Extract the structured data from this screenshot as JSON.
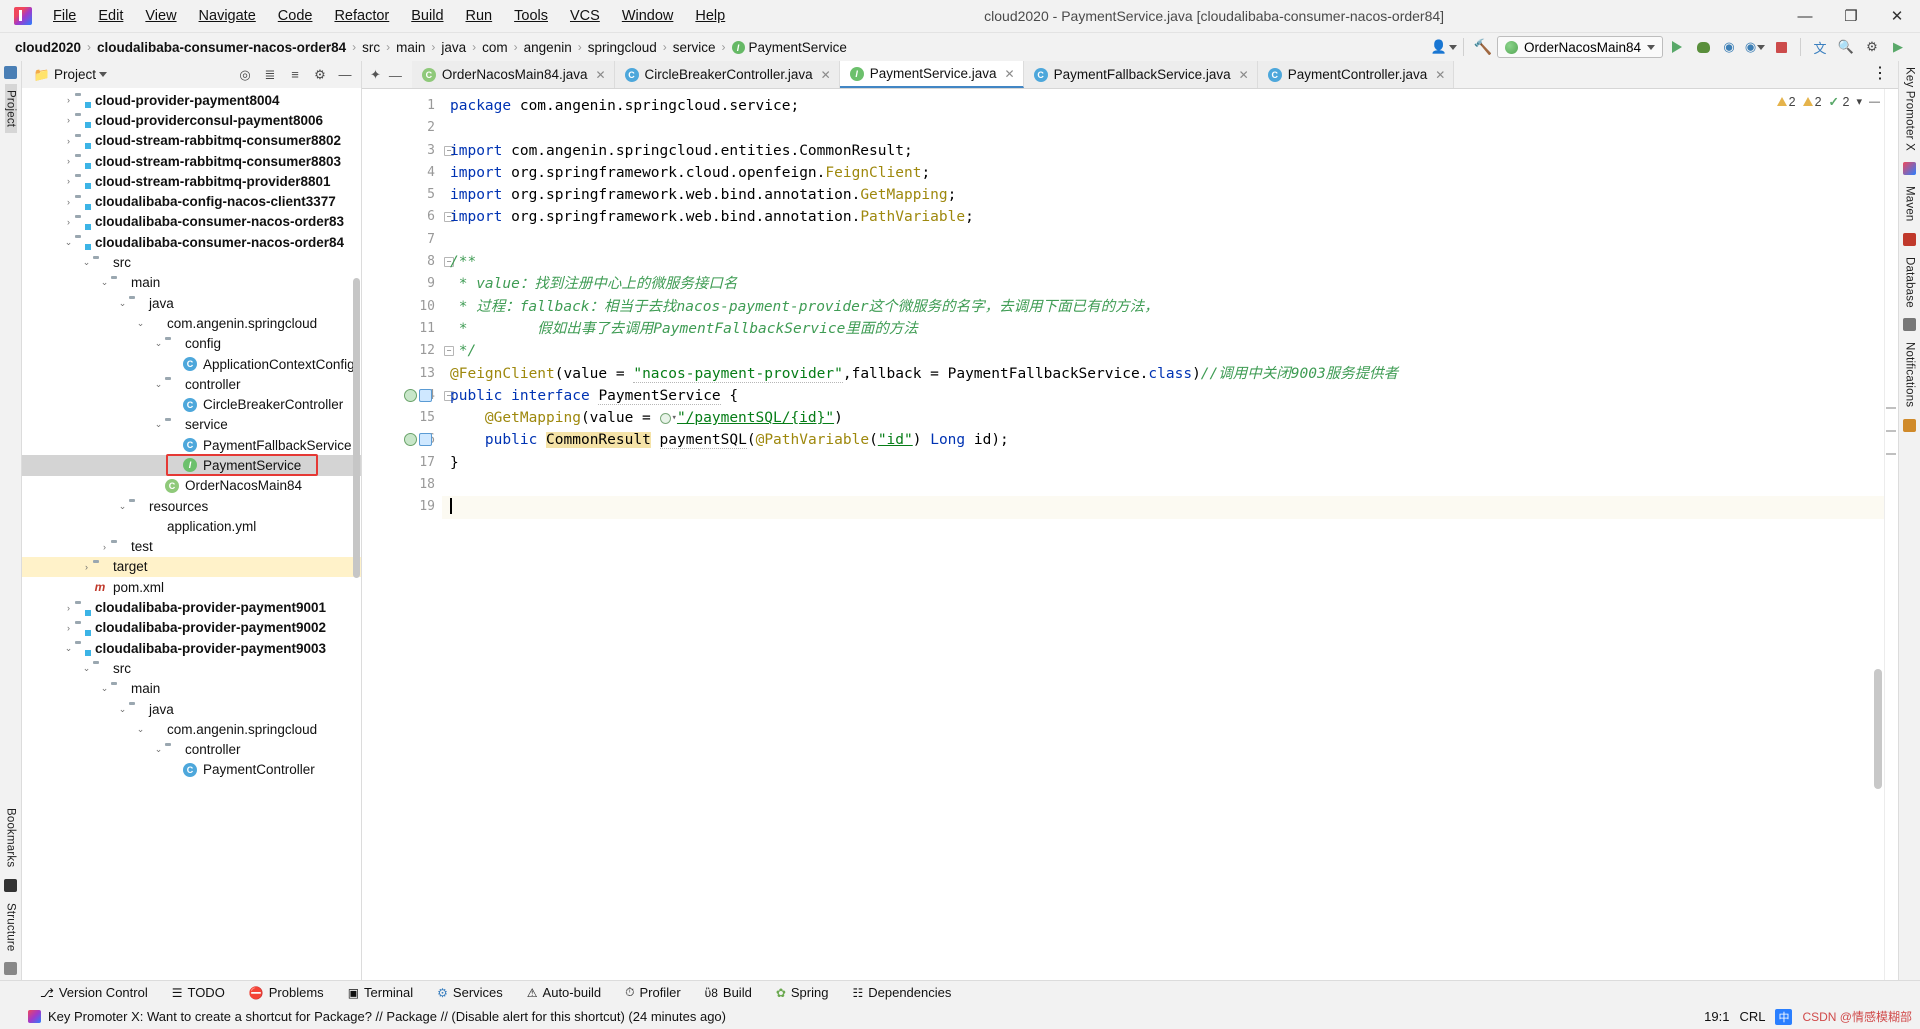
{
  "window": {
    "title": "cloud2020 - PaymentService.java [cloudalibaba-consumer-nacos-order84]",
    "minimize": "—",
    "maximize": "❐",
    "close": "✕"
  },
  "menu": [
    "File",
    "Edit",
    "View",
    "Navigate",
    "Code",
    "Refactor",
    "Build",
    "Run",
    "Tools",
    "VCS",
    "Window",
    "Help"
  ],
  "breadcrumb": {
    "items": [
      "cloud2020",
      "cloudalibaba-consumer-nacos-order84",
      "src",
      "main",
      "java",
      "com",
      "angenin",
      "springcloud",
      "service",
      "PaymentService"
    ],
    "separator": "›",
    "last_icon": "I"
  },
  "toolbar": {
    "run_config": "OrderNacosMain84",
    "icons": [
      "user-dropdown-icon",
      "build-hammer-icon",
      "run-icon",
      "debug-icon",
      "run-with-coverage-icon",
      "profiler-icon",
      "stop-icon",
      "translate-icon",
      "search-icon",
      "settings-icon",
      "ide-help-icon"
    ]
  },
  "project_panel": {
    "title": "Project",
    "header_icons": [
      "select-opened-file-icon",
      "expand-all-icon",
      "collapse-all-icon",
      "settings-icon",
      "hide-icon"
    ],
    "tree": [
      {
        "depth": 2,
        "label": "cloud-provider-payment8004",
        "icon": "module-folder",
        "arrow": "›",
        "bold": true
      },
      {
        "depth": 2,
        "label": "cloud-providerconsul-payment8006",
        "icon": "module-folder",
        "arrow": "›",
        "bold": true
      },
      {
        "depth": 2,
        "label": "cloud-stream-rabbitmq-consumer8802",
        "icon": "module-folder",
        "arrow": "›",
        "bold": true
      },
      {
        "depth": 2,
        "label": "cloud-stream-rabbitmq-consumer8803",
        "icon": "module-folder",
        "arrow": "›",
        "bold": true
      },
      {
        "depth": 2,
        "label": "cloud-stream-rabbitmq-provider8801",
        "icon": "module-folder",
        "arrow": "›",
        "bold": true
      },
      {
        "depth": 2,
        "label": "cloudalibaba-config-nacos-client3377",
        "icon": "module-folder",
        "arrow": "›",
        "bold": true
      },
      {
        "depth": 2,
        "label": "cloudalibaba-consumer-nacos-order83",
        "icon": "module-folder",
        "arrow": "›",
        "bold": true
      },
      {
        "depth": 2,
        "label": "cloudalibaba-consumer-nacos-order84",
        "icon": "module-folder",
        "arrow": "⌄",
        "bold": true
      },
      {
        "depth": 3,
        "label": "src",
        "icon": "source-folder",
        "arrow": "⌄",
        "bold": false
      },
      {
        "depth": 4,
        "label": "main",
        "icon": "folder",
        "arrow": "⌄",
        "bold": false
      },
      {
        "depth": 5,
        "label": "java",
        "icon": "source-folder",
        "arrow": "⌄",
        "bold": false
      },
      {
        "depth": 6,
        "label": "com.angenin.springcloud",
        "icon": "package",
        "arrow": "⌄",
        "bold": false
      },
      {
        "depth": 7,
        "label": "config",
        "icon": "folder",
        "arrow": "⌄",
        "bold": false
      },
      {
        "depth": 8,
        "label": "ApplicationContextConfig",
        "icon": "class",
        "arrow": "",
        "bold": false
      },
      {
        "depth": 7,
        "label": "controller",
        "icon": "folder",
        "arrow": "⌄",
        "bold": false
      },
      {
        "depth": 8,
        "label": "CircleBreakerController",
        "icon": "class",
        "arrow": "",
        "bold": false
      },
      {
        "depth": 7,
        "label": "service",
        "icon": "folder",
        "arrow": "⌄",
        "bold": false
      },
      {
        "depth": 8,
        "label": "PaymentFallbackService",
        "icon": "class",
        "arrow": "",
        "bold": false
      },
      {
        "depth": 8,
        "label": "PaymentService",
        "icon": "interface",
        "arrow": "",
        "bold": false,
        "selected": true,
        "boxed": true
      },
      {
        "depth": 7,
        "label": "OrderNacosMain84",
        "icon": "spring-class",
        "arrow": "",
        "bold": false
      },
      {
        "depth": 5,
        "label": "resources",
        "icon": "resource-folder",
        "arrow": "⌄",
        "bold": false
      },
      {
        "depth": 6,
        "label": "application.yml",
        "icon": "yaml",
        "arrow": "",
        "bold": false
      },
      {
        "depth": 4,
        "label": "test",
        "icon": "test-folder",
        "arrow": "›",
        "bold": false
      },
      {
        "depth": 3,
        "label": "target",
        "icon": "target-folder",
        "arrow": "›",
        "bold": false,
        "highlight": true
      },
      {
        "depth": 3,
        "label": "pom.xml",
        "icon": "maven",
        "arrow": "",
        "bold": false
      },
      {
        "depth": 2,
        "label": "cloudalibaba-provider-payment9001",
        "icon": "module-folder",
        "arrow": "›",
        "bold": true
      },
      {
        "depth": 2,
        "label": "cloudalibaba-provider-payment9002",
        "icon": "module-folder",
        "arrow": "›",
        "bold": true
      },
      {
        "depth": 2,
        "label": "cloudalibaba-provider-payment9003",
        "icon": "module-folder",
        "arrow": "⌄",
        "bold": true
      },
      {
        "depth": 3,
        "label": "src",
        "icon": "folder",
        "arrow": "⌄",
        "bold": false
      },
      {
        "depth": 4,
        "label": "main",
        "icon": "folder",
        "arrow": "⌄",
        "bold": false
      },
      {
        "depth": 5,
        "label": "java",
        "icon": "source-folder",
        "arrow": "⌄",
        "bold": false
      },
      {
        "depth": 6,
        "label": "com.angenin.springcloud",
        "icon": "package",
        "arrow": "⌄",
        "bold": false
      },
      {
        "depth": 7,
        "label": "controller",
        "icon": "folder",
        "arrow": "⌄",
        "bold": false
      },
      {
        "depth": 8,
        "label": "PaymentController",
        "icon": "class",
        "arrow": "",
        "bold": false
      }
    ]
  },
  "tabs": [
    {
      "label": "OrderNacosMain84.java",
      "icon": "spring-class-icon",
      "active": false
    },
    {
      "label": "CircleBreakerController.java",
      "icon": "class-icon",
      "active": false
    },
    {
      "label": "PaymentService.java",
      "icon": "interface-icon",
      "active": true
    },
    {
      "label": "PaymentFallbackService.java",
      "icon": "class-icon",
      "active": false
    },
    {
      "label": "PaymentController.java",
      "icon": "class-icon",
      "active": false
    }
  ],
  "code": {
    "lines": [
      "1",
      "2",
      "3",
      "4",
      "5",
      "6",
      "7",
      "8",
      "9",
      "10",
      "11",
      "12",
      "13",
      "14",
      "15",
      "16",
      "17",
      "18",
      "19"
    ],
    "current_line": 19,
    "text": {
      "l1": "package com.angenin.springcloud.service;",
      "l3": "import com.angenin.springcloud.entities.CommonResult;",
      "l4": "import org.springframework.cloud.openfeign.FeignClient;",
      "l5": "import org.springframework.web.bind.annotation.GetMapping;",
      "l6": "import org.springframework.web.bind.annotation.PathVariable;",
      "l8": "/**",
      "l9": " * value：找到注册中心上的微服务接口名",
      "l10": " * 过程：fallback：相当于去找nacos-payment-provider这个微服务的名字，去调用下面已有的方法，",
      "l11": " *        假如出事了去调用PaymentFallbackService里面的方法",
      "l12": " */",
      "l13": "@FeignClient(value = \"nacos-payment-provider\",fallback = PaymentFallbackService.class)//调用中关闭9003服务提供者",
      "l14": "public interface PaymentService {",
      "l15": "    @GetMapping(value = \"/paymentSQL/{id}\")",
      "l16": "    public CommonResult paymentSQL(@PathVariable(\"id\") Long id);",
      "l17": "}"
    }
  },
  "analysis": {
    "warnings1": "2",
    "warnings2": "2",
    "checks": "2"
  },
  "right_rail": [
    "Key Promoter X",
    "Maven",
    "Database",
    "Notifications"
  ],
  "left_rail": [
    "Project",
    "Bookmarks",
    "Structure"
  ],
  "bottom_tools": [
    {
      "label": "Version Control",
      "icon": "branch-icon"
    },
    {
      "label": "TODO",
      "icon": "list-icon"
    },
    {
      "label": "Problems",
      "icon": "error-icon"
    },
    {
      "label": "Terminal",
      "icon": "terminal-icon"
    },
    {
      "label": "Services",
      "icon": "services-icon"
    },
    {
      "label": "Auto-build",
      "icon": "warning-icon"
    },
    {
      "label": "Profiler",
      "icon": "profiler-icon"
    },
    {
      "label": "Build",
      "icon": "hammer-icon"
    },
    {
      "label": "Spring",
      "icon": "spring-icon"
    },
    {
      "label": "Dependencies",
      "icon": "dependencies-icon"
    }
  ],
  "statusbar": {
    "message": "Key Promoter X: Want to create a shortcut for Package? // Package // (Disable alert for this shortcut) (24 minutes ago)",
    "position": "19:1",
    "line_sep": "CRL",
    "ime": "中",
    "watermark": "CSDN @情感模糊部"
  }
}
